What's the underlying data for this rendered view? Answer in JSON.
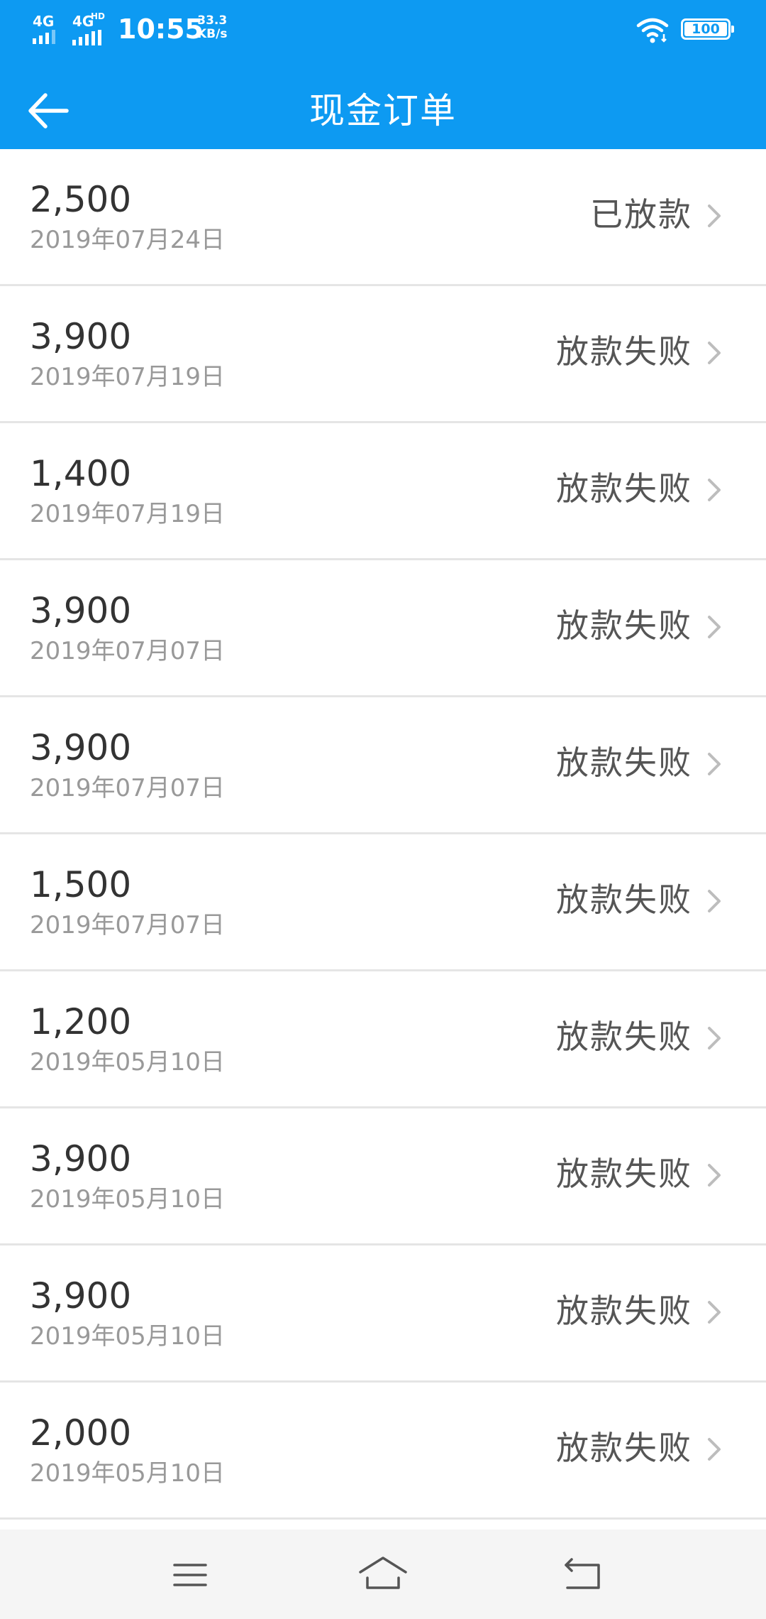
{
  "status_bar": {
    "signal1_label": "4G",
    "signal2_label": "4G",
    "signal2_badge": "HD",
    "time": "10:55",
    "net_speed_value": "33.3",
    "net_speed_unit": "KB/s",
    "battery_level": "100"
  },
  "header": {
    "title": "现金订单",
    "back_icon": "arrow-left-icon",
    "background_color": "#0d9af2"
  },
  "orders": [
    {
      "amount": "2,500",
      "date": "2019年07月24日",
      "status": "已放款"
    },
    {
      "amount": "3,900",
      "date": "2019年07月19日",
      "status": "放款失败"
    },
    {
      "amount": "1,400",
      "date": "2019年07月19日",
      "status": "放款失败"
    },
    {
      "amount": "3,900",
      "date": "2019年07月07日",
      "status": "放款失败"
    },
    {
      "amount": "3,900",
      "date": "2019年07月07日",
      "status": "放款失败"
    },
    {
      "amount": "1,500",
      "date": "2019年07月07日",
      "status": "放款失败"
    },
    {
      "amount": "1,200",
      "date": "2019年05月10日",
      "status": "放款失败"
    },
    {
      "amount": "3,900",
      "date": "2019年05月10日",
      "status": "放款失败"
    },
    {
      "amount": "3,900",
      "date": "2019年05月10日",
      "status": "放款失败"
    },
    {
      "amount": "2,000",
      "date": "2019年05月10日",
      "status": "放款失败"
    }
  ],
  "nav_bar": {
    "menu_icon": "menu-icon",
    "home_icon": "home-icon",
    "back_icon": "back-return-icon"
  }
}
